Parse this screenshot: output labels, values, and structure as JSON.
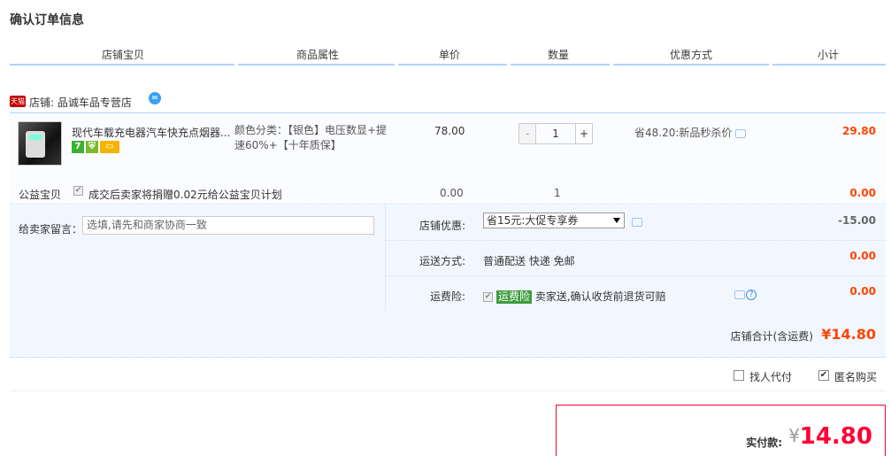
{
  "title": "确认订单信息",
  "header": {
    "col_shop_item": "店铺宝贝",
    "col_attr": "商品属性",
    "col_price": "单价",
    "col_qty": "数量",
    "col_promo": "优惠方式",
    "col_subtotal": "小计"
  },
  "shop": {
    "tag": "天猫",
    "label": "店铺: 品诚车品专营店"
  },
  "item": {
    "title": "现代车载充电器汽车快充点烟器...",
    "badge_7": "7",
    "attr_text": "颜色分类：【银色】电压数显+提速60%+【十年质保】",
    "price": "78.00",
    "qty_minus": "-",
    "qty_value": "1",
    "qty_plus": "+",
    "promo": "省48.20:新品秒杀价",
    "subtotal": "29.80"
  },
  "charity": {
    "label": "公益宝贝",
    "desc": "成交后卖家将捐赠0.02元给公益宝贝计划",
    "price": "0.00",
    "qty": "1",
    "subtotal": "0.00"
  },
  "memo": {
    "label": "给卖家留言：",
    "placeholder": "选填,请先和商家协商一致"
  },
  "shop_discount": {
    "label": "店铺优惠:",
    "selected": "省15元:大促专享券",
    "amount": "-15.00"
  },
  "shipping": {
    "label": "运送方式:",
    "value": "普通配送 快递 免邮",
    "amount": "0.00"
  },
  "freight_insurance": {
    "label": "运费险:",
    "tag": "运费险",
    "value": "卖家送,确认收货前退货可赔",
    "amount": "0.00"
  },
  "shop_total": {
    "label": "店铺合计(含运费)",
    "value": "¥14.80"
  },
  "options": {
    "pay_for_me": "找人代付",
    "anonymous": "匿名购买"
  },
  "payment": {
    "label": "实付款:",
    "currency": "¥",
    "amount": "14.80"
  },
  "colors": {
    "accent": "#ff0036",
    "price_red": "#ff4400",
    "header_line": "#b2d1ff",
    "panel_bg": "#f2f7ff"
  }
}
